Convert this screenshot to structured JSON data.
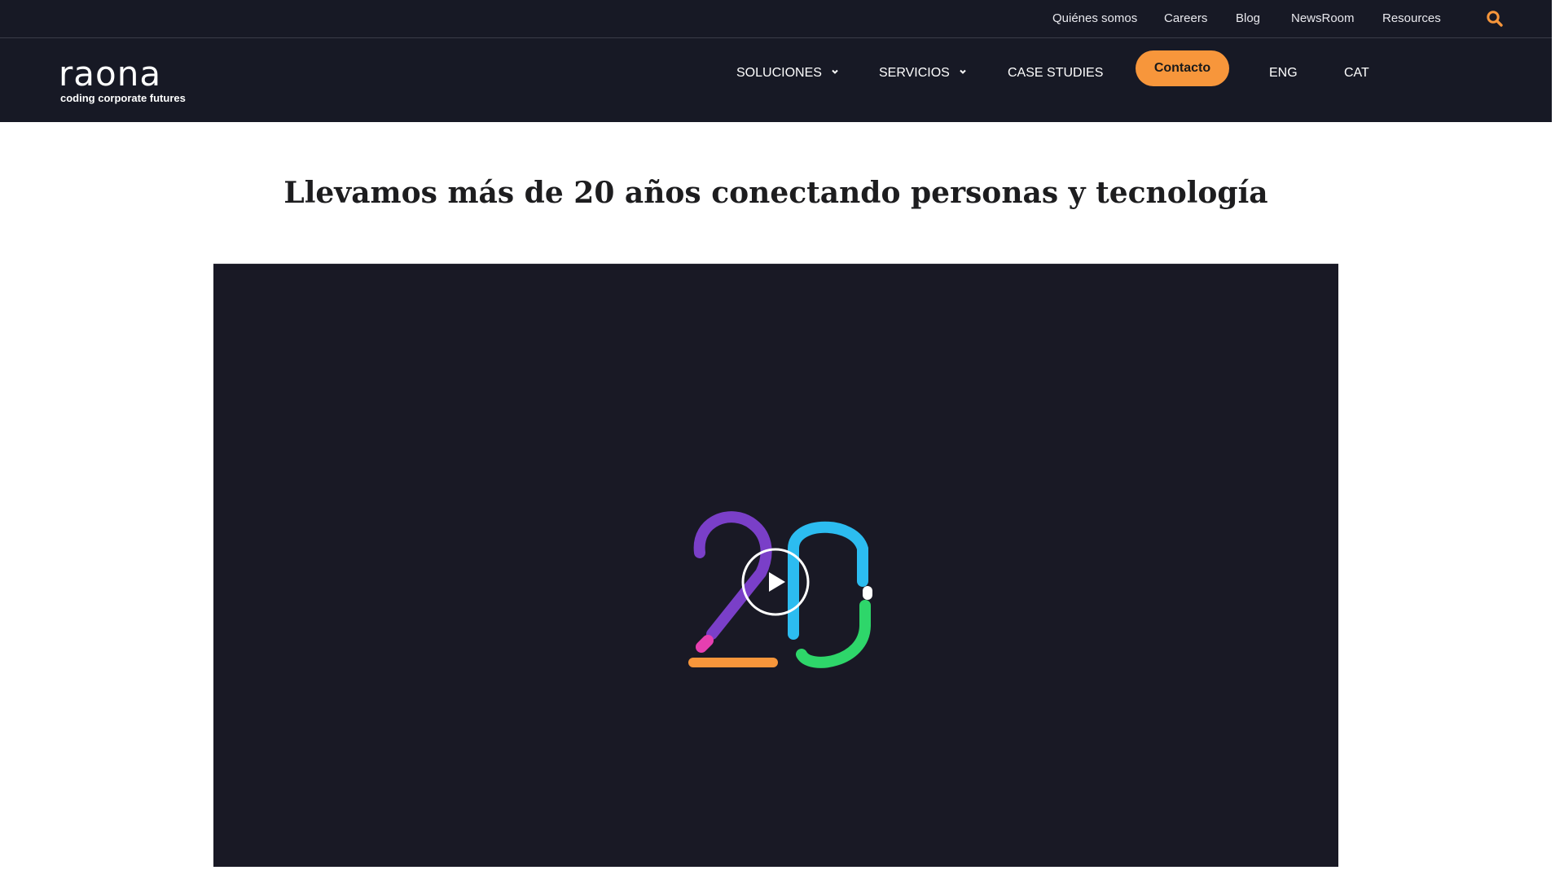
{
  "topbar": {
    "links": [
      "Quiénes somos",
      "Careers",
      "Blog",
      "NewsRoom",
      "Resources"
    ],
    "search_icon": "search-icon"
  },
  "header": {
    "logo_text": "raona",
    "logo_tagline": "coding corporate futures",
    "nav": {
      "soluciones": "SOLUCIONES",
      "servicios": "SERVICIOS",
      "case_studies": "CASE STUDIES",
      "contacto": "Contacto",
      "eng": "ENG",
      "cat": "CAT"
    }
  },
  "main": {
    "headline": "Llevamos más de 20 años conectando personas y tecnología",
    "video": {
      "artwork": "20",
      "play_icon": "play-icon"
    }
  },
  "colors": {
    "header_bg": "#171925",
    "accent": "#f7963b",
    "video_bg": "#191925",
    "art_purple": "#7a3fc8",
    "art_magenta": "#e63fb0",
    "art_orange": "#f7963b",
    "art_cyan": "#2cbcf0",
    "art_green": "#2ed66a"
  }
}
